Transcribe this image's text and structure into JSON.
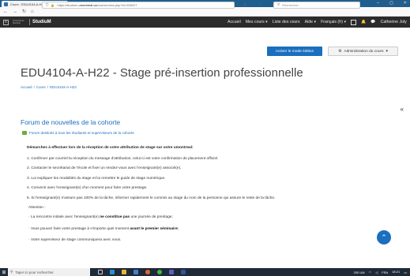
{
  "browser": {
    "tab_title": "Cours : EDU4104-A-H22 - Stag",
    "url_prefix": "https://studium.",
    "url_domain": "umontreal.ca",
    "url_suffix": "/course/view.php?id=208227",
    "search_placeholder": "Rechercher"
  },
  "header": {
    "logo_small": "Université de Montréal",
    "logo": "StudiuM",
    "menu": [
      "Accueil",
      "Mes cours",
      "Liste des cours",
      "Aide",
      "Français (fr)"
    ],
    "user_name": "Catherine Joly"
  },
  "toolbar": {
    "edit_mode": "Activer le mode édition",
    "admin": "Administration du cours"
  },
  "page": {
    "title": "EDU4104-A-H22 - Stage pré-insertion professionnelle",
    "breadcrumb": [
      "Accueil",
      "Cours",
      "EDU4104-A-H22"
    ]
  },
  "forum": {
    "title": "Forum de nouvelles de la cohorte",
    "subtitle": "Forum destinés à tous les étudiants et superviseurs de la cohorte",
    "intro": "Démarches à effectuer lors de la réception de votre attribution de stage sur votre umontreal:",
    "steps": [
      "1.  Confirmer par courriel la réception du message d'attribution, celui-ci est votre confirmation de placement officiel.",
      "2.  Contacter le secrétariat de l'école et fixer un rendez-vous avec l'enseignant(e) associé(e).",
      "3.  Lui expliquer les modalités du stage et lui remettre le guide de stage numérique.",
      "4.  Convenir avec l'enseignant(e) d'un moment pour faire votre prestage.",
      "5.  Si l'enseignant(e) n'assure pas 100% de la tâche, informer rapidement le commis au stage du nom de la personne qui assure le reste de la tâche."
    ],
    "attention": "Attention :",
    "bullets": [
      {
        "before": "La rencontre initiale avec l'enseignant(e) ",
        "bold": "ne constitue pas",
        "after": " une journée de prestage;"
      },
      {
        "before": "Vous pouvez faire votre prestage à n'importe quel moment ",
        "bold": "avant le premier séminaire",
        "after": ";"
      },
      {
        "before": "Votre superviseur de stage communiquera avec vous.",
        "bold": "",
        "after": ""
      }
    ]
  },
  "taskbar": {
    "search": "Taper ici pour rechercher",
    "lang": "FRA",
    "time": "18:21",
    "temp": "200 UM"
  },
  "colors": {
    "link": "#1a6fbe",
    "header_bg": "#2b2b2b",
    "tab_bg": "#1f5f8f"
  }
}
